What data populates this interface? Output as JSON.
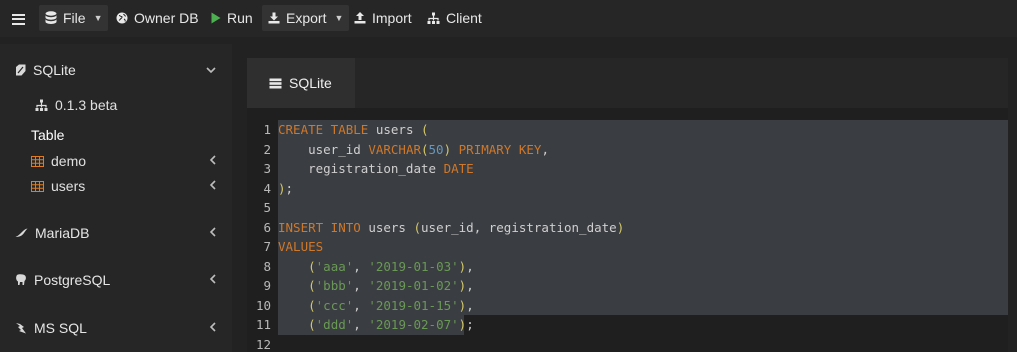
{
  "toolbar": {
    "menu_icon": "hamburger-icon",
    "file_label": "File",
    "owner_db_label": "Owner DB",
    "run_label": "Run",
    "export_label": "Export",
    "import_label": "Import",
    "client_label": "Client"
  },
  "sidebar": {
    "databases": [
      {
        "label": "SQLite",
        "icon": "feather-icon",
        "expanded": true
      },
      {
        "label": "MariaDB",
        "icon": "seal-icon",
        "expanded": false
      },
      {
        "label": "PostgreSQL",
        "icon": "elephant-icon",
        "expanded": false
      },
      {
        "label": "MS SQL",
        "icon": "server-icon",
        "expanded": false
      }
    ],
    "version_label": "0.1.3 beta",
    "table_heading": "Table",
    "tables": [
      {
        "label": "demo",
        "icon": "table-icon"
      },
      {
        "label": "users",
        "icon": "table-icon"
      }
    ]
  },
  "main": {
    "tabs": [
      {
        "label": "SQLite",
        "icon": "database-icon",
        "active": true
      }
    ]
  },
  "editor": {
    "selection": "lines 1-11",
    "line_numbers": [
      "1",
      "2",
      "3",
      "4",
      "5",
      "6",
      "7",
      "8",
      "9",
      "10",
      "11",
      "12"
    ],
    "lines": [
      "CREATE TABLE users (",
      "    user_id VARCHAR(50) PRIMARY KEY,",
      "    registration_date DATE",
      ");",
      "",
      "INSERT INTO users (user_id, registration_date)",
      "VALUES",
      "    ('aaa', '2019-01-03'),",
      "    ('bbb', '2019-01-02'),",
      "    ('ccc', '2019-01-15'),",
      "    ('ddd', '2019-02-07');",
      ""
    ]
  },
  "colors": {
    "keyword": "#d0782a",
    "string": "#6a9955",
    "number": "#6897bb",
    "selection": "#3a3d41",
    "run_icon": "#4caf50"
  }
}
